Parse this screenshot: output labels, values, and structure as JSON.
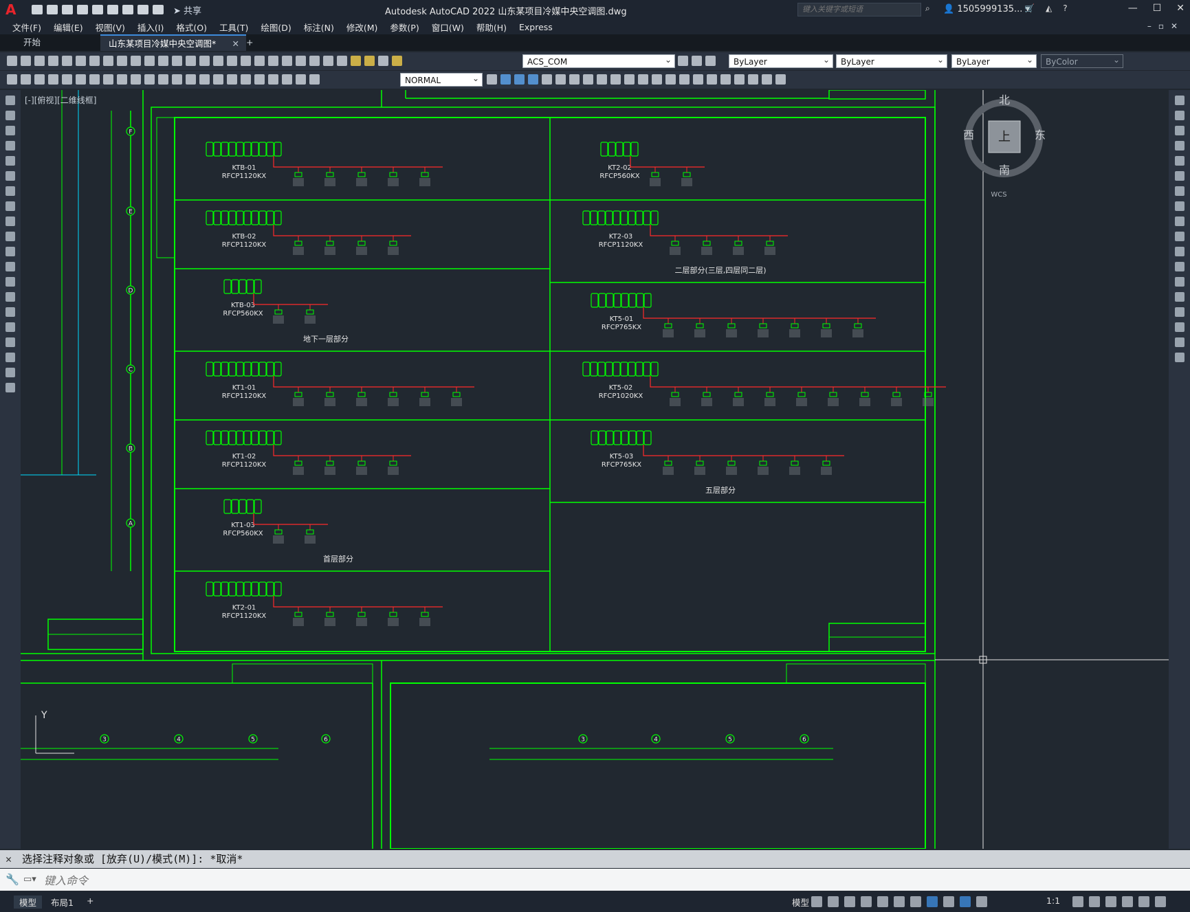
{
  "app": {
    "logo": "A",
    "share": "共享",
    "title": "Autodesk AutoCAD 2022    山东某项目冷媒中央空调图.dwg",
    "search_placeholder": "键入关键字或短语",
    "user": "1505999135..."
  },
  "menu": [
    "文件(F)",
    "编辑(E)",
    "视图(V)",
    "插入(I)",
    "格式(O)",
    "工具(T)",
    "绘图(D)",
    "标注(N)",
    "修改(M)",
    "参数(P)",
    "窗口(W)",
    "帮助(H)",
    "Express"
  ],
  "tabs": {
    "start": "开始",
    "doc": "山东某项目冷媒中央空调图*",
    "plus": "+"
  },
  "toolbar": {
    "layer": "ACS_COM",
    "color": "ByLayer",
    "linetype": "ByLayer",
    "lineweight": "ByLayer",
    "plotstyle": "ByColor",
    "dimstyle": "NORMAL"
  },
  "viewcube": {
    "north": "北",
    "south": "南",
    "east": "东",
    "west": "西",
    "top": "上",
    "wcs": "WCS"
  },
  "view_label": "[-][俯视][二维线框]",
  "drawing": {
    "units": [
      {
        "name": "KTB-01",
        "model": "RFCP1120KX"
      },
      {
        "name": "KTB-02",
        "model": "RFCP1120KX"
      },
      {
        "name": "KTB-03",
        "model": "RFCP560KX"
      },
      {
        "name": "KT1-01",
        "model": "RFCP1120KX"
      },
      {
        "name": "KT1-02",
        "model": "RFCP1120KX"
      },
      {
        "name": "KT1-03",
        "model": "RFCP560KX"
      },
      {
        "name": "KT2-01",
        "model": "RFCP1120KX"
      },
      {
        "name": "KT2-02",
        "model": "RFCP560KX"
      },
      {
        "name": "KT2-03",
        "model": "RFCP1120KX"
      },
      {
        "name": "KT5-01",
        "model": "RFCP765KX"
      },
      {
        "name": "KT5-02",
        "model": "RFCP1020KX"
      },
      {
        "name": "KT5-03",
        "model": "RFCP765KX"
      }
    ],
    "sections": {
      "basement": "地下一层部分",
      "first": "首层部分",
      "second": "二层部分(三层,四层同二层)",
      "fifth": "五层部分"
    },
    "grid_letters": [
      "F",
      "E",
      "D",
      "C",
      "B",
      "A"
    ],
    "grid_numbers": [
      "3",
      "4",
      "5",
      "6"
    ],
    "ucs_y": "Y"
  },
  "command": {
    "history": "选择注释对象或 [放弃(U)/模式(M)]: *取消*",
    "placeholder": "键入命令"
  },
  "statusbar": {
    "model": "模型",
    "layout1": "布局1",
    "add": "+",
    "model_label": "模型",
    "scale": "1:1"
  },
  "colors": {
    "accent": "#3d8bdb",
    "cad_green": "#00ff00",
    "cad_red": "#ff2a2a",
    "canvas": "#212830"
  }
}
